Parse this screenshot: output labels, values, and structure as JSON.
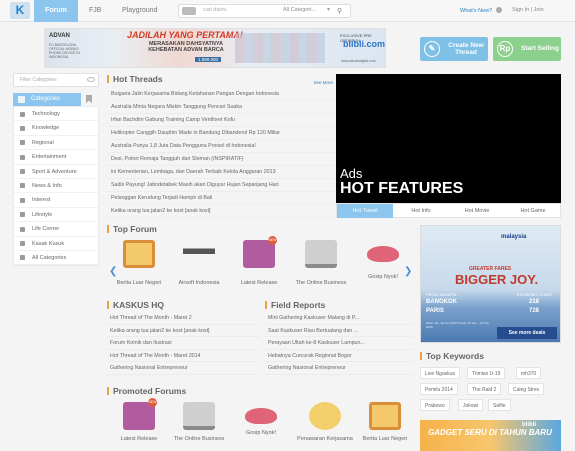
{
  "header": {
    "logo": "K",
    "tabs": [
      {
        "label": "Forum",
        "active": true
      },
      {
        "label": "FJB",
        "active": false
      },
      {
        "label": "Playground",
        "active": false
      }
    ],
    "search": {
      "placeholder": "cari disini",
      "category": "All Categori..."
    },
    "whats_new": "What's New?",
    "sign_in": "Sign In | Join"
  },
  "banner": {
    "brand": "ADVAN",
    "brand_sub": "FC BARCELONA OFFICIAL MOBILE PHONE DEVICE IN INDONESIA",
    "title": "JADILAH YANG PERTAMA!",
    "subtitle": "MERASAKAN DAHSYATNYA KEHEBATAN ADVAN BARCA",
    "price": "1.999.000",
    "preorder": "EXCLUSIVE PRE ORDER DI",
    "shop": "blibli.com",
    "url": "www.advandigital.com"
  },
  "actions": {
    "create_thread": "Create New Thread",
    "start_selling": "Start Selling"
  },
  "sidebar": {
    "filter_placeholder": "Filter Categories",
    "active": "Categories",
    "items": [
      "Technology",
      "Knowledge",
      "Regional",
      "Entertainment",
      "Sport & Adventure",
      "News & Info",
      "Interest",
      "Lifestyle",
      "Life Corner",
      "Kasak Kusuk",
      "All Categories"
    ]
  },
  "hot_threads": {
    "title": "Hot Threads",
    "see_more": "See More",
    "items": [
      "Bulgaria Jalin Kerjasama Bidang Ketahanan Pangan Dengan Indonesia",
      "Australia Minta Negara Miskin Tanggung Pencari Suaka",
      "Irfan Bachdim Gabung Training Camp Ventforet Kofu",
      "Helikopter Canggih Dauphin Made in Bandung Dibanderol Rp 120 Miliar",
      "Australia Punya 1,8 Juta Data Pengguna Ponsel di Indonesia!",
      "Desi, Potret Remaja Tangguh dari Sleman (INSPIRATIF)",
      "ini Kementerian, Lembaga, dan Daerah Terbaik Kelola Anggaran 2013",
      "Sadis Payung! Jabodetabek Masih akan Diguyur Hujan Sepanjang Hari",
      "Pelanggan Kerudung Terjadi Hampir di Bali",
      "Ketika orang tua jalan2 ke kost [anak kost]"
    ]
  },
  "ads": {
    "line1": "Ads",
    "line2": "HOT FEATURES",
    "tabs": [
      "Hot Travel",
      "Hot Info",
      "Hot Movie",
      "Hot Game"
    ]
  },
  "top_forum": {
    "title": "Top Forum",
    "items": [
      {
        "label": "Berita Luar Negeri",
        "icon": "tv-icon",
        "badge": ""
      },
      {
        "label": "Airsoft Indonesia",
        "icon": "airsoft-gun-icon",
        "badge": ""
      },
      {
        "label": "Latest Release",
        "icon": "book-icon",
        "badge": "NEW"
      },
      {
        "label": "The Online Business",
        "icon": "laptop-icon",
        "badge": ""
      },
      {
        "label": "Gosip Nyok!",
        "icon": "lips-icon",
        "badge": ""
      }
    ]
  },
  "kaskus_hq": {
    "title": "KASKUS HQ",
    "items": [
      "Hot Thread of The Month - Maret 2",
      "Ketika orang tua jalan2 ke kost [anak kost]",
      "Forum Komik dan Ilustrasi",
      "Hot Thread of The Month - Maret 2014",
      "Gathering Nasional Entrepreneur"
    ]
  },
  "field_reports": {
    "title": "Field Reports",
    "items": [
      "Mini Gathering Kaskuser Malang di P...",
      "Saat Kaskuser Riau Bertualang dan ...",
      "Perayaan Ultah ke-8 Kaskuser Lampun...",
      "Hebatnya Curcurak Regional Bogor",
      "Gathering Nasional Entrepreneur"
    ]
  },
  "promoted": {
    "title": "Promoted Forums",
    "items": [
      {
        "label": "Latest Release",
        "icon": "book-icon",
        "badge": "NEW"
      },
      {
        "label": "The Online Business",
        "icon": "laptop-icon",
        "badge": ""
      },
      {
        "label": "Gosip Nyok!",
        "icon": "lips-icon",
        "badge": ""
      },
      {
        "label": "Penawaran Kerjasama",
        "icon": "hand-icon",
        "badge": ""
      },
      {
        "label": "Berita Luar Negeri",
        "icon": "tv-icon",
        "badge": ""
      }
    ]
  },
  "malaysia_ad": {
    "brand": "malaysia",
    "greater": "GREATER FARES",
    "headline": "BIGGER JOY.",
    "from": "FROM JAKARTA",
    "class": "ECONOMY CLASS",
    "routes": [
      {
        "city": "BANGKOK",
        "price": "218"
      },
      {
        "city": "PARIS",
        "price": "728"
      }
    ],
    "fine": "Book: 19 - 30 Jan 2015 Travel: 15 Jan - 15 Nov 2015",
    "cta": "See more deals"
  },
  "top_keywords": {
    "title": "Top Keywords",
    "items": [
      "Live Ngaskus",
      "Trimias U-19",
      "mh370",
      "Pemilu 2014",
      "The Raid 2",
      "Caleg Stres",
      "Prabowo",
      "Jokowi",
      "Selfie"
    ]
  },
  "bottom_ad": {
    "text": "GADGET SERU DI TAHUN BARU",
    "brand": "blibli"
  },
  "colors": {
    "accent": "#8cc6ee",
    "create": "#7fc1e6",
    "sell": "#8bd18d",
    "highlight": "#f0a044"
  }
}
